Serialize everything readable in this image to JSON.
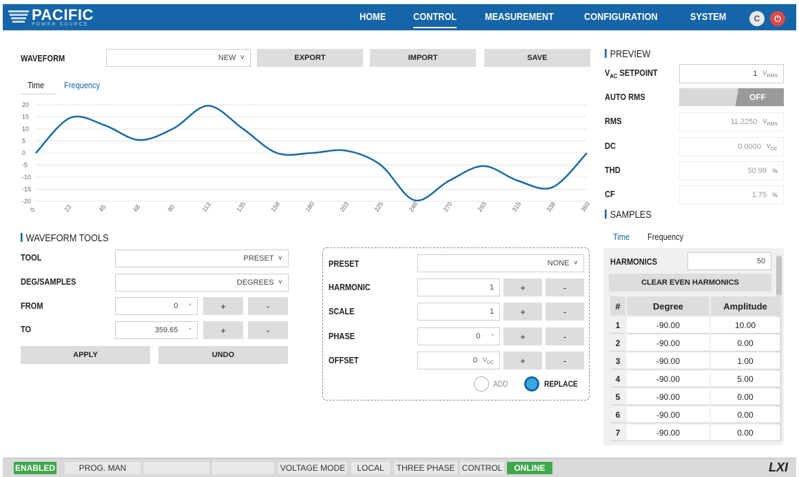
{
  "brand": {
    "name": "PACIFIC",
    "sub": "POWER SOURCE"
  },
  "nav": [
    {
      "label": "HOME"
    },
    {
      "label": "CONTROL"
    },
    {
      "label": "MEASUREMENT"
    },
    {
      "label": "CONFIGURATION"
    },
    {
      "label": "SYSTEM"
    }
  ],
  "header_icons": [
    "refresh-icon",
    "power-icon"
  ],
  "waveform": {
    "label": "WAVEFORM",
    "select_value": "NEW",
    "export": "EXPORT",
    "import": "IMPORT",
    "save": "SAVE"
  },
  "view_tabs": {
    "time": "Time",
    "frequency": "Frequency"
  },
  "chart_data": {
    "type": "line",
    "x": [
      0,
      22.5,
      45,
      67.5,
      90,
      112.5,
      135,
      157.5,
      180,
      202.5,
      225,
      247.5,
      270,
      292.5,
      315,
      337.5,
      360
    ],
    "xticks": [
      "0",
      "23",
      "45",
      "68",
      "90",
      "113",
      "135",
      "158",
      "180",
      "203",
      "225",
      "248",
      "270",
      "293",
      "315",
      "338",
      "360"
    ],
    "yticks": [
      "20",
      "15",
      "10",
      "5",
      "0",
      "-5",
      "-10",
      "-15",
      "-20"
    ],
    "ylim": [
      -20,
      20
    ],
    "y": [
      0,
      14.6,
      11.5,
      5.4,
      10.2,
      19.6,
      10.2,
      0,
      0,
      1.0,
      -4.8,
      -19.6,
      -11.5,
      -5.4,
      -11.5,
      -14.2,
      0
    ],
    "color": "#1a6aa6"
  },
  "tools": {
    "title": "WAVEFORM TOOLS",
    "tool_label": "TOOL",
    "tool_value": "PRESET",
    "deg_label": "DEG/SAMPLES",
    "deg_value": "DEGREES",
    "from_label": "FROM",
    "from_value": "0",
    "from_unit": "°",
    "to_label": "TO",
    "to_value": "359.65",
    "to_unit": "°",
    "plus": "+",
    "minus": "-",
    "apply": "APPLY",
    "undo": "UNDO"
  },
  "preset": {
    "preset_label": "PRESET",
    "preset_value": "NONE",
    "harmonic_label": "HARMONIC",
    "harmonic_value": "1",
    "scale_label": "SCALE",
    "scale_value": "1",
    "phase_label": "PHASE",
    "phase_value": "0",
    "phase_unit": "°",
    "offset_label": "OFFSET",
    "offset_value": "0",
    "offset_unit": "V",
    "offset_unit_sub": "DC",
    "add": "ADD",
    "replace": "REPLACE"
  },
  "preview": {
    "title": "PREVIEW",
    "vac_label": "V",
    "vac_label_sub": "AC",
    "vac_label_rest": " SETPOINT",
    "vac_value": "1",
    "vac_unit": "V",
    "vac_unit_sub": "RMS",
    "autorms_label": "AUTO RMS",
    "autorms_value": "OFF",
    "rms_label": "RMS",
    "rms_value": "11.2250",
    "rms_unit": "V",
    "rms_unit_sub": "RMS",
    "dc_label": "DC",
    "dc_value": "0.0000",
    "dc_unit": "V",
    "dc_unit_sub": "DC",
    "thd_label": "THD",
    "thd_value": "50.99",
    "thd_unit": "%",
    "cf_label": "CF",
    "cf_value": "1.75",
    "cf_unit": "%"
  },
  "samples": {
    "title": "SAMPLES",
    "tab_time": "Time",
    "tab_freq": "Frequency",
    "harmonics_label": "HARMONICS",
    "harmonics_value": "50",
    "clear": "CLEAR EVEN HARMONICS",
    "cols": [
      "#",
      "Degree",
      "Amplitude"
    ],
    "rows": [
      {
        "n": "1",
        "deg": "-90.00",
        "amp": "10.00"
      },
      {
        "n": "2",
        "deg": "-90.00",
        "amp": "0.00"
      },
      {
        "n": "3",
        "deg": "-90.00",
        "amp": "1.00"
      },
      {
        "n": "4",
        "deg": "-90.00",
        "amp": "5.00"
      },
      {
        "n": "5",
        "deg": "-90.00",
        "amp": "0.00"
      },
      {
        "n": "6",
        "deg": "-90.00",
        "amp": "0.00"
      },
      {
        "n": "7",
        "deg": "-90.00",
        "amp": "0.00"
      }
    ]
  },
  "status": {
    "enabled": "ENABLED",
    "prog": "PROG. MAN",
    "voltage": "VOLTAGE MODE",
    "local": "LOCAL",
    "phase": "THREE PHASE",
    "control": "CONTROL",
    "online": "ONLINE",
    "lxi": "LXI"
  }
}
